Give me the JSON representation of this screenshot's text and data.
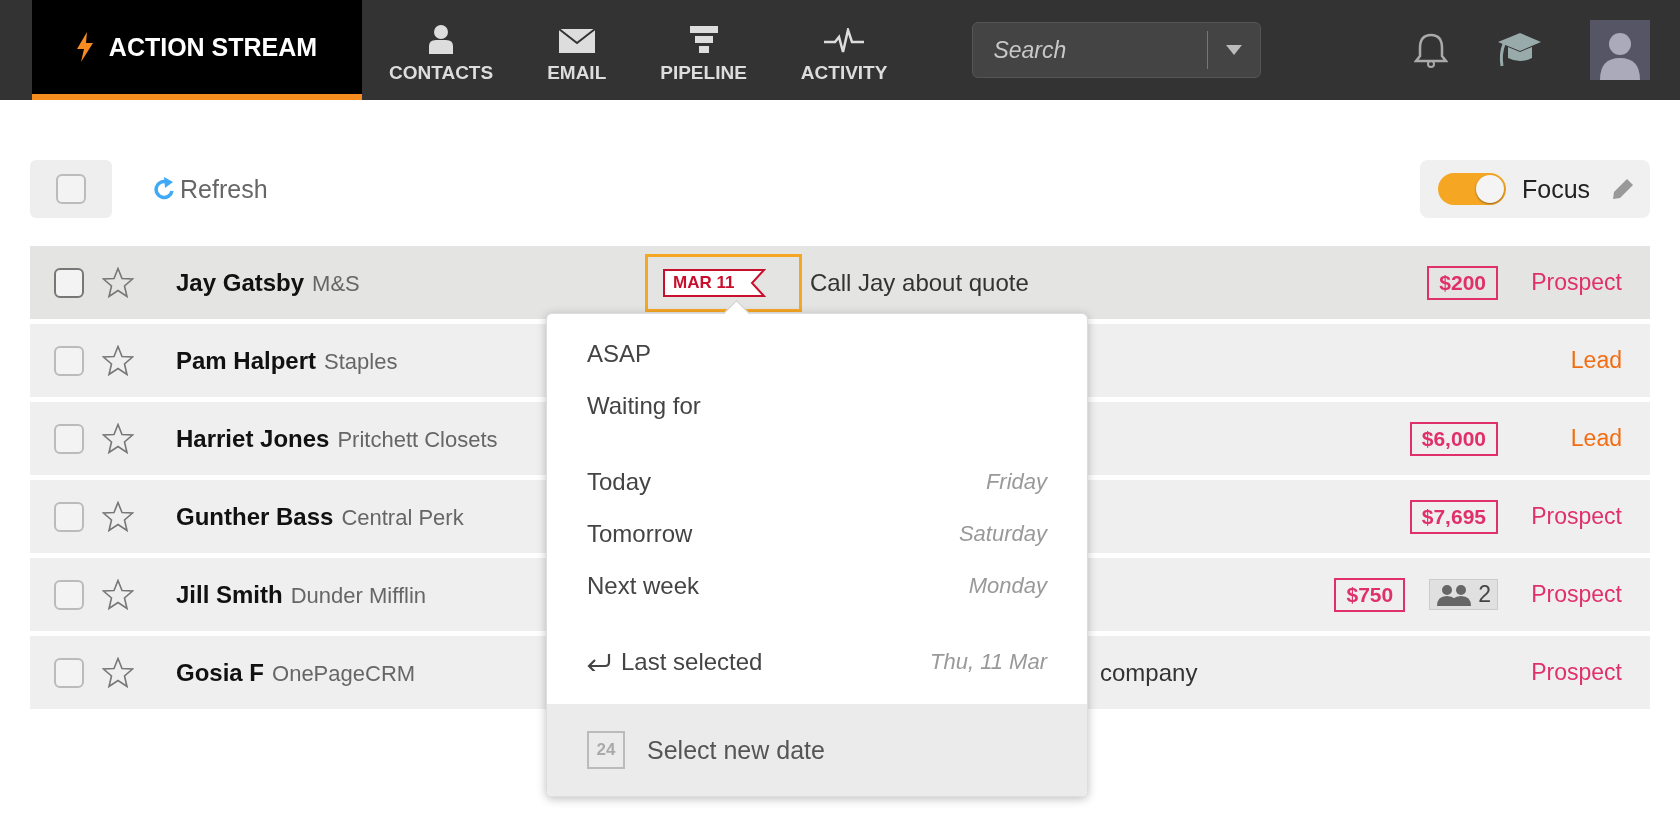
{
  "nav": {
    "tabs": [
      {
        "label": "ACTION STREAM",
        "selected": true
      },
      {
        "label": "CONTACTS",
        "selected": false
      },
      {
        "label": "EMAIL",
        "selected": false
      },
      {
        "label": "PIPELINE",
        "selected": false
      },
      {
        "label": "ACTIVITY",
        "selected": false
      }
    ],
    "search": {
      "placeholder": "Search"
    }
  },
  "toolbar": {
    "select_all": {
      "checked": false
    },
    "refresh": "Refresh",
    "focus": {
      "label": "Focus",
      "on": true
    }
  },
  "rows": [
    {
      "selected": true,
      "checked": false,
      "starred": false,
      "name": "Jay Gatsby",
      "company": "M&S",
      "date": "MAR 11",
      "task": "Call Jay about quote",
      "amount": "$200",
      "status": "Prospect",
      "color": "#e0306a"
    },
    {
      "selected": false,
      "checked": false,
      "starred": false,
      "name": "Pam Halpert",
      "company": "Staples",
      "status": "Lead",
      "color": "#f26d12"
    },
    {
      "selected": false,
      "checked": false,
      "starred": false,
      "name": "Harriet Jones",
      "company": "Pritchett Closets",
      "amount": "$6,000",
      "status": "Lead",
      "color": "#f26d12"
    },
    {
      "selected": false,
      "checked": false,
      "starred": false,
      "name": "Gunther Bass",
      "company": "Central Perk",
      "amount": "$7,695",
      "status": "Prospect",
      "color": "#e0306a"
    },
    {
      "selected": false,
      "checked": false,
      "starred": false,
      "name": "Jill Smith",
      "company": "Dunder Mifflin",
      "amount": "$750",
      "contacts": "2",
      "status": "Prospect",
      "color": "#e0306a"
    },
    {
      "selected": false,
      "checked": false,
      "starred": false,
      "name": "Gosia F",
      "company": "OnePageCRM",
      "task": "company",
      "status": "Prospect",
      "color": "#e0306a"
    }
  ],
  "date_menu": {
    "sections": [
      {
        "items": [
          {
            "label": "ASAP"
          },
          {
            "label": "Waiting for"
          }
        ]
      },
      {
        "items": [
          {
            "label": "Today",
            "hint": "Friday"
          },
          {
            "label": "Tomorrow",
            "hint": "Saturday"
          },
          {
            "label": "Next week",
            "hint": "Monday"
          }
        ]
      },
      {
        "items": [
          {
            "label": "Last selected",
            "hint": "Thu, 11 Mar",
            "kind": "return"
          }
        ]
      }
    ],
    "footer": {
      "label": "Select new date",
      "calendar_day": "24"
    }
  }
}
